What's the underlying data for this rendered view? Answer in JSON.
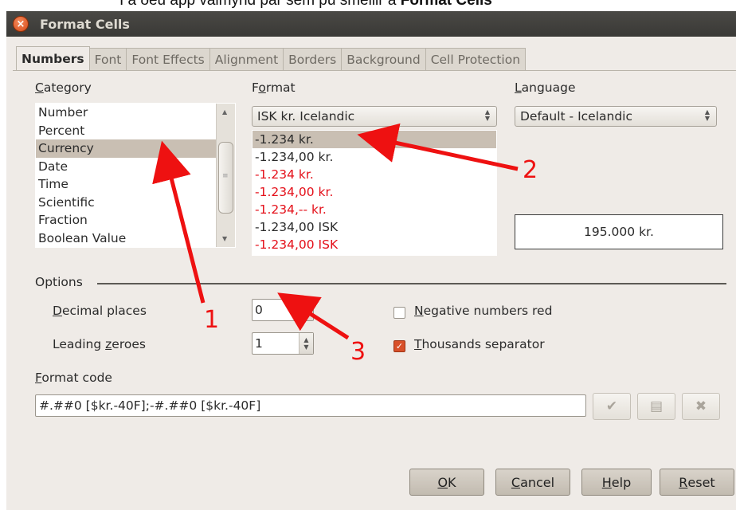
{
  "caption": {
    "prefix": "Í a",
    "middle": "ðeu app valmynd þar sem þú smellir á",
    "bold": "Format Cells"
  },
  "window": {
    "title": "Format Cells",
    "close_glyph": "×"
  },
  "tabs": [
    "Numbers",
    "Font",
    "Font Effects",
    "Alignment",
    "Borders",
    "Background",
    "Cell Protection"
  ],
  "category": {
    "label": "Category",
    "label_mnemonic": "C",
    "label_rest": "ategory",
    "items": [
      "Number",
      "Percent",
      "Currency",
      "Date",
      "Time",
      "Scientific",
      "Fraction",
      "Boolean Value"
    ],
    "selected": 2
  },
  "format": {
    "label_pre": "F",
    "label_mnemonic": "o",
    "label_rest": "rmat",
    "currency_value": "ISK  kr.  Icelandic",
    "items": [
      {
        "text": "-1.234 kr.",
        "red": false
      },
      {
        "text": "-1.234,00 kr.",
        "red": false
      },
      {
        "text": "-1.234 kr.",
        "red": true
      },
      {
        "text": "-1.234,00 kr.",
        "red": true
      },
      {
        "text": "-1.234,-- kr.",
        "red": true
      },
      {
        "text": "-1.234,00 ISK",
        "red": false
      },
      {
        "text": "-1.234,00 ISK",
        "red": true
      }
    ],
    "selected": 0
  },
  "language": {
    "label_mnemonic": "L",
    "label_rest": "anguage",
    "value": "Default - Icelandic"
  },
  "preview": "195.000 kr.",
  "options": {
    "label": "Options",
    "decimal_places": {
      "label_mnemonic": "D",
      "label_rest": "ecimal places",
      "value": "0"
    },
    "leading_zeroes": {
      "label_pre": "Leading ",
      "label_mnemonic": "z",
      "label_rest": "eroes",
      "value": "1"
    },
    "negative_red": {
      "label_mnemonic": "N",
      "label_rest": "egative numbers red",
      "checked": false
    },
    "thousands_sep": {
      "label_mnemonic": "T",
      "label_rest": "housands separator",
      "checked": true
    }
  },
  "format_code": {
    "label_mnemonic": "F",
    "label_rest": "ormat code",
    "value": "#.##0 [$kr.-40F];-#.##0 [$kr.-40F]"
  },
  "buttons": {
    "ok_mnemonic": "O",
    "ok_rest": "K",
    "cancel_mnemonic": "C",
    "cancel_rest": "ancel",
    "help_mnemonic": "H",
    "help_rest": "elp",
    "reset_mnemonic": "R",
    "reset_rest": "eset"
  },
  "annotations": [
    "1",
    "2",
    "3"
  ],
  "colors": {
    "annotation": "#ee1111",
    "negative": "#e4101a",
    "selection": "#c9bfb3",
    "checkbox": "#d8502a"
  }
}
